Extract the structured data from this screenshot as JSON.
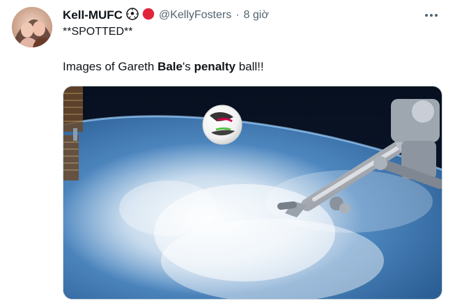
{
  "tweet": {
    "display_name": "Kell-MUFC",
    "emojis": [
      "soccer-ball-emoji",
      "red-circle-emoji"
    ],
    "handle": "@KellyFosters",
    "separator": "·",
    "time": "8 giờ",
    "line1": "**SPOTTED**",
    "line2_parts": {
      "a": "Images of Gareth ",
      "b": "Bale",
      "c": "'s ",
      "d": "penalty",
      "e": " ball!!"
    }
  },
  "colors": {
    "text": "#0f1419",
    "secondary": "#536471",
    "border": "#cfd9de",
    "space": "#0b1220"
  },
  "icons": {
    "more": "more-horizontal-icon"
  }
}
